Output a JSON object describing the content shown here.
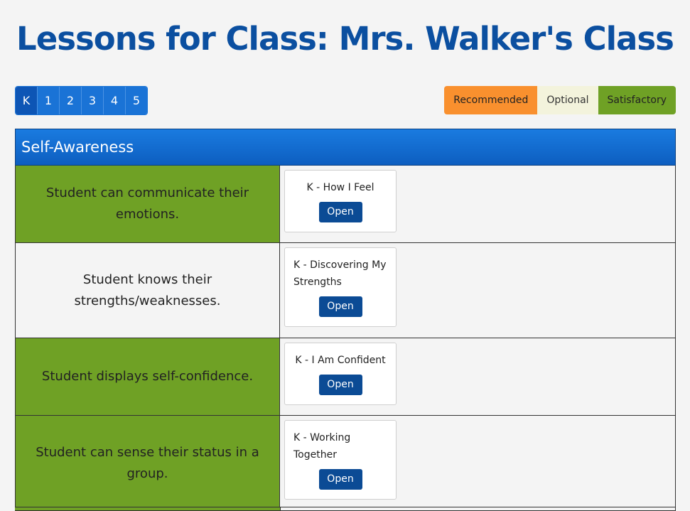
{
  "page": {
    "title": "Lessons for Class: Mrs. Walker's Class"
  },
  "grades": [
    "K",
    "1",
    "2",
    "3",
    "4",
    "5"
  ],
  "active_grade": "K",
  "legend": {
    "recommended": "Recommended",
    "optional": "Optional",
    "satisfactory": "Satisfactory"
  },
  "colors": {
    "recommended": "#f9902e",
    "optional": "#f3f3dc",
    "satisfactory": "#6fa125",
    "header": "#1a73d6"
  },
  "section": {
    "title": "Self-Awareness",
    "rows": [
      {
        "skill": "Student can communicate their emotions.",
        "status": "satisfactory",
        "lesson": "K - How I Feel",
        "button": "Open"
      },
      {
        "skill": "Student knows their strengths/weaknesses.",
        "status": "optional",
        "lesson": "K - Discovering My Strengths",
        "button": "Open"
      },
      {
        "skill": "Student displays self-confidence.",
        "status": "satisfactory",
        "lesson": "K - I Am Confident",
        "button": "Open"
      },
      {
        "skill": "Student can sense their status in a group.",
        "status": "satisfactory",
        "lesson": "K - Working Together",
        "button": "Open"
      }
    ]
  }
}
